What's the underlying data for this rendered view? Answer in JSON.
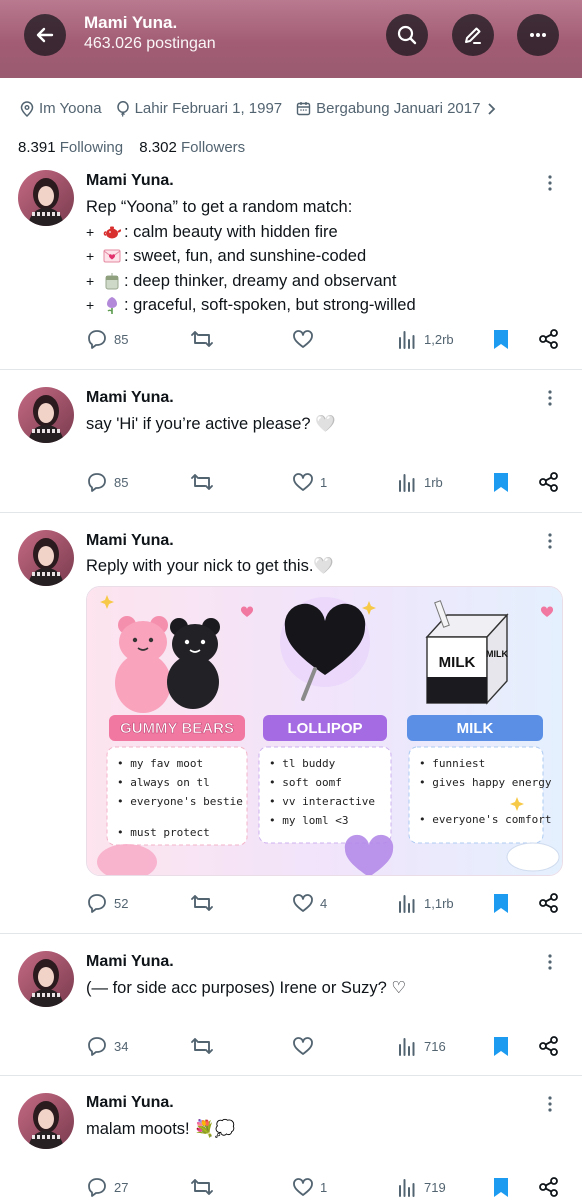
{
  "header": {
    "name": "Mami Yuna.",
    "post_count": "463.026 postingan"
  },
  "profile": {
    "location": "Im Yoona",
    "birthday": "Lahir Februari 1, 1997",
    "joined": "Bergabung Januari 2017",
    "following_count": "8.391",
    "following_label": "Following",
    "followers_count": "8.302",
    "followers_label": "Followers"
  },
  "colors": {
    "header": "#a25d74",
    "bookmark": "#1d9bf0",
    "muted": "#536471"
  },
  "posts": [
    {
      "author": "Mami Yuna.",
      "intro": "Rep “Yoona” to get a random match:",
      "lines": [
        {
          "emoji": "teapot-emoji",
          "text": ": calm beauty with hidden fire"
        },
        {
          "emoji": "love-letter-emoji",
          "text": ": sweet, fun, and sunshine-coded"
        },
        {
          "emoji": "tea-cup-emoji",
          "text": ": deep thinker, dreamy and observant"
        },
        {
          "emoji": "tulip-emoji",
          "text": ": graceful, soft-spoken, but strong-willed"
        }
      ],
      "replies": "85",
      "likes": "",
      "views": "1,2rb"
    },
    {
      "author": "Mami Yuna.",
      "text": "say 'Hi' if you’re active please? 🤍",
      "replies": "85",
      "likes": "1",
      "views": "1rb"
    },
    {
      "author": "Mami Yuna.",
      "text": "Reply with your nick to get this.🤍",
      "replies": "52",
      "likes": "4",
      "views": "1,1rb",
      "image": {
        "panels": [
          {
            "title": "GUMMY BEARS",
            "items": [
              "my fav moot",
              "always on tl",
              "everyone's bestie",
              "must protect"
            ]
          },
          {
            "title": "LOLLIPOP",
            "items": [
              "tl buddy",
              "soft oomf",
              "vv interactive",
              "my loml <3"
            ]
          },
          {
            "title": "MILK",
            "items": [
              "funniest",
              "gives happy energy",
              "everyone's comfort"
            ]
          }
        ],
        "carton_label": "MILK",
        "carton_label_side": "MILK"
      }
    },
    {
      "author": "Mami Yuna.",
      "text": "(— for side acc purposes) Irene or Suzy? ♡",
      "replies": "34",
      "likes": "",
      "views": "716"
    },
    {
      "author": "Mami Yuna.",
      "text": "malam moots! 💐💭",
      "replies": "27",
      "likes": "1",
      "views": "719"
    }
  ]
}
